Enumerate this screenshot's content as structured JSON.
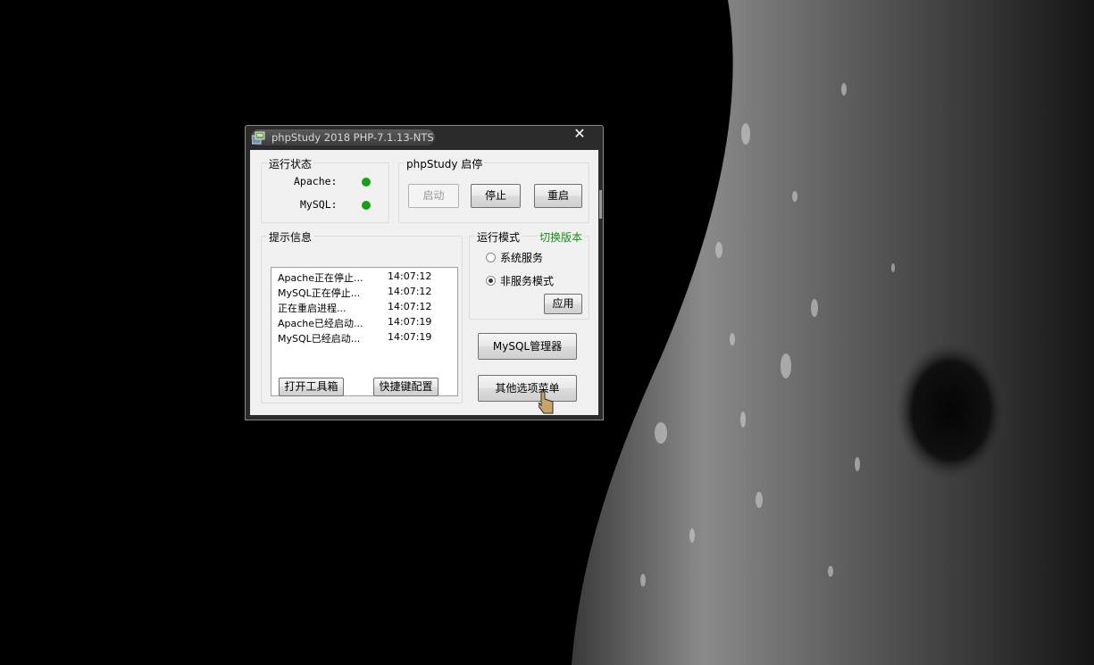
{
  "window": {
    "title": "phpStudy 2018   PHP-7.1.13-NTS",
    "close_glyph": "✕"
  },
  "status_group": {
    "legend": "运行状态",
    "services": [
      {
        "label": "Apache:",
        "status": "running",
        "color": "#15a015"
      },
      {
        "label": "MySQL:",
        "status": "running",
        "color": "#15a015"
      }
    ]
  },
  "control_group": {
    "legend": "phpStudy 启停",
    "start_label": "启动",
    "stop_label": "停止",
    "restart_label": "重启"
  },
  "info_group": {
    "legend": "提示信息",
    "logs": [
      {
        "msg": "Apache正在停止...",
        "time": "14:07:12"
      },
      {
        "msg": "MySQL正在停止...",
        "time": "14:07:12"
      },
      {
        "msg": "正在重启进程...",
        "time": "14:07:12"
      },
      {
        "msg": "Apache已经启动...",
        "time": "14:07:19"
      },
      {
        "msg": "MySQL已经启动...",
        "time": "14:07:19"
      }
    ],
    "toolbox_label": "打开工具箱",
    "shortcut_label": "快捷键配置"
  },
  "mode_group": {
    "legend": "运行模式",
    "switch_version_link": "切换版本",
    "options": [
      {
        "label": "系统服务",
        "selected": false
      },
      {
        "label": "非服务模式",
        "selected": true
      }
    ],
    "apply_label": "应用"
  },
  "side_buttons": {
    "mysql_manager_label": "MySQL管理器",
    "other_menu_label": "其他选项菜单"
  },
  "colors": {
    "status_running": "#15a015",
    "link_green": "#1a8c1a",
    "window_frame": "#2b2b2b"
  },
  "icons": {
    "app": "phpstudy-app-icon",
    "cursor": "hand-pointer-cursor"
  }
}
